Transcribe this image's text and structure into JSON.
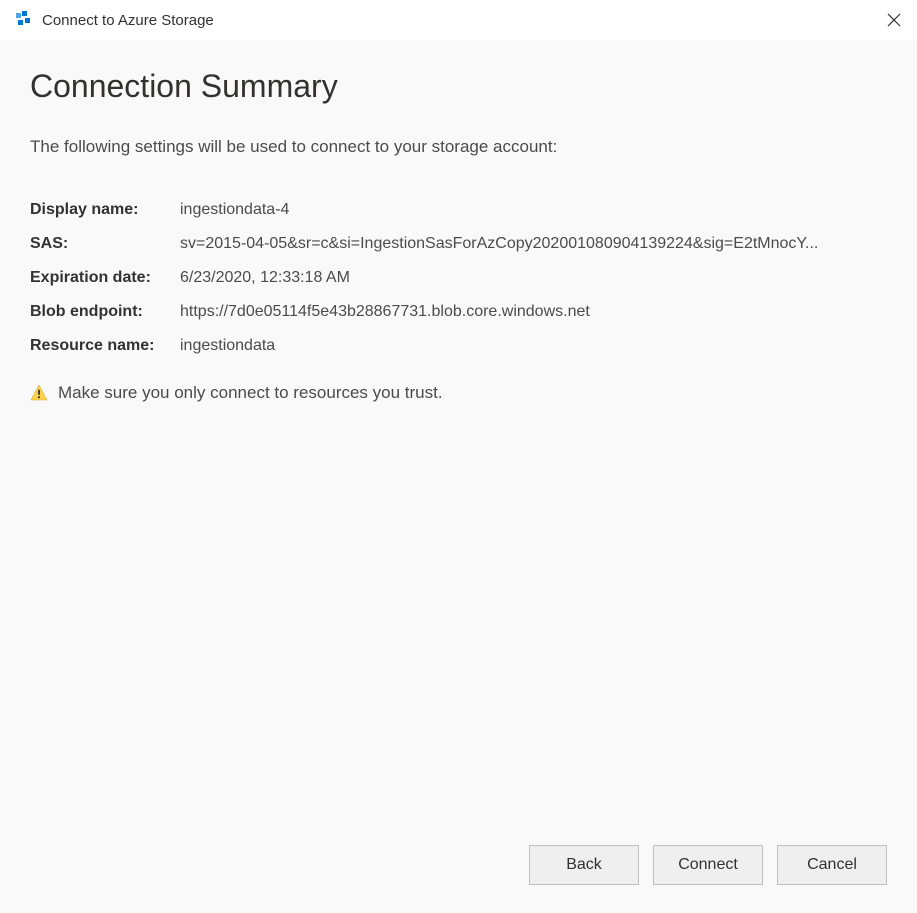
{
  "titlebar": {
    "title": "Connect to Azure Storage"
  },
  "page": {
    "heading": "Connection Summary",
    "description": "The following settings will be used to connect to your storage account:"
  },
  "settings": {
    "display_name": {
      "label": "Display name:",
      "value": "ingestiondata-4"
    },
    "sas": {
      "label": "SAS:",
      "value": "sv=2015-04-05&sr=c&si=IngestionSasForAzCopy202001080904139224&sig=E2tMnocY..."
    },
    "expiration": {
      "label": "Expiration date:",
      "value": "6/23/2020, 12:33:18 AM"
    },
    "blob_endpoint": {
      "label": "Blob endpoint:",
      "value": "https://7d0e05114f5e43b28867731.blob.core.windows.net"
    },
    "resource_name": {
      "label": "Resource name:",
      "value": "ingestiondata"
    }
  },
  "warning": {
    "text": "Make sure you only connect to resources you trust."
  },
  "buttons": {
    "back": "Back",
    "connect": "Connect",
    "cancel": "Cancel"
  }
}
